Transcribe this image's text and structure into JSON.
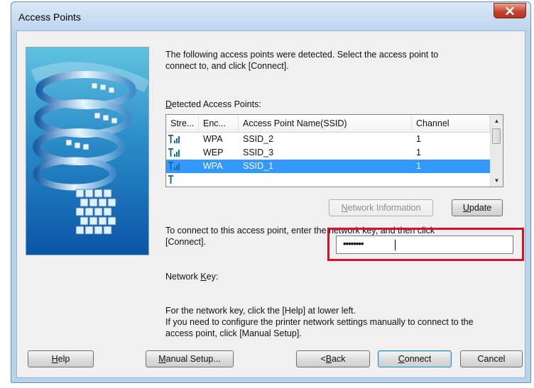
{
  "window": {
    "title": "Access Points",
    "close_icon": "close-x-icon"
  },
  "intro_line1": "The following access points were detected. Select the access point to",
  "intro_line2": "connect to, and click [Connect].",
  "detected_label": "Detected Access Points:",
  "list": {
    "columns": [
      "Stre...",
      "Enc...",
      "Access Point Name(SSID)",
      "Channel"
    ],
    "rows": [
      {
        "signal_icon": "signal-strength-icon",
        "encryption": "WPA",
        "ssid": "SSID_2",
        "channel": "1",
        "selected": false
      },
      {
        "signal_icon": "signal-strength-icon",
        "encryption": "WEP",
        "ssid": "SSID_3",
        "channel": "1",
        "selected": false
      },
      {
        "signal_icon": "signal-strength-icon",
        "encryption": "WPA",
        "ssid": "SSID_1",
        "channel": "1",
        "selected": true
      }
    ]
  },
  "buttons": {
    "network_information": "Network Information",
    "update": "Update",
    "help": "Help",
    "manual_setup": "Manual Setup...",
    "back": "<Back",
    "connect": "Connect",
    "cancel": "Cancel"
  },
  "connect_line1": "To connect to this access point, enter the network key, and then click",
  "connect_line2": "[Connect].",
  "network_key_label": "Network Key:",
  "network_key_value": "••••••••",
  "help_line1": "For the network key, click the [Help] at lower left.",
  "help_line2": "If you need to configure the printer network settings manually to connect to the",
  "help_line3": "access point, click [Manual Setup].",
  "colors": {
    "highlight_box": "#d8102a",
    "selection": "#3399ff"
  }
}
